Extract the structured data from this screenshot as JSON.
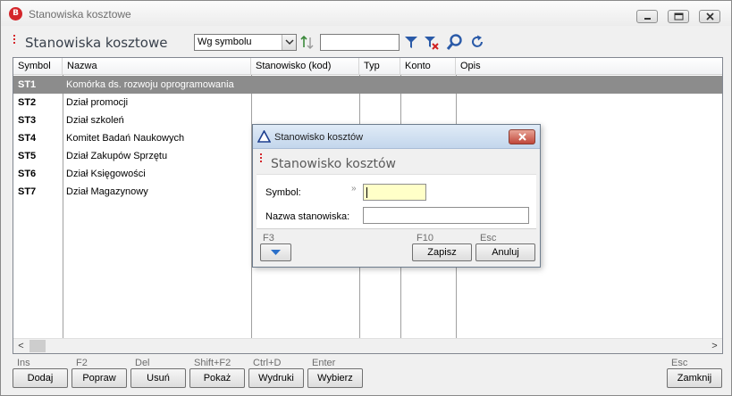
{
  "window": {
    "title": "Stanowiska kosztowe",
    "app_badge": "B"
  },
  "header": {
    "title": "Stanowiska kosztowe",
    "sort_select": {
      "value": "Wg symbolu"
    },
    "search": {
      "value": ""
    }
  },
  "grid": {
    "columns": [
      "Symbol",
      "Nazwa",
      "Stanowisko (kod)",
      "Typ",
      "Konto",
      "Opis"
    ],
    "rows": [
      {
        "symbol": "ST1",
        "name": "Komórka ds. rozwoju oprogramowania",
        "selected": true
      },
      {
        "symbol": "ST2",
        "name": "Dział promocji"
      },
      {
        "symbol": "ST3",
        "name": "Dział szkoleń"
      },
      {
        "symbol": "ST4",
        "name": "Komitet Badań Naukowych"
      },
      {
        "symbol": "ST5",
        "name": "Dział Zakupów Sprzętu"
      },
      {
        "symbol": "ST6",
        "name": "Dział Księgowości"
      },
      {
        "symbol": "ST7",
        "name": "Dział Magazynowy"
      }
    ],
    "scroll_left": "<",
    "scroll_right": ">"
  },
  "toolbar": {
    "buttons": [
      {
        "key": "Ins",
        "label": "Dodaj"
      },
      {
        "key": "F2",
        "label": "Popraw"
      },
      {
        "key": "Del",
        "label": "Usuń"
      },
      {
        "key": "Shift+F2",
        "label": "Pokaż"
      },
      {
        "key": "Ctrl+D",
        "label": "Wydruki"
      },
      {
        "key": "Enter",
        "label": "Wybierz"
      },
      {
        "key": "Esc",
        "label": "Zamknij"
      }
    ]
  },
  "dialog": {
    "title": "Stanowisko kosztów",
    "heading": "Stanowisko kosztów",
    "fields": {
      "symbol_label": "Symbol:",
      "symbol_marker": "»",
      "symbol_value": "",
      "name_label": "Nazwa stanowiska:",
      "name_value": ""
    },
    "more_key": "F3",
    "save_key": "F10",
    "save_label": "Zapisz",
    "cancel_key": "Esc",
    "cancel_label": "Anuluj"
  },
  "colors": {
    "accent": "#d4262b",
    "selection": "#8c8c8c",
    "dialog_title": "#c3d6ec",
    "required_field": "#ffffc8"
  }
}
